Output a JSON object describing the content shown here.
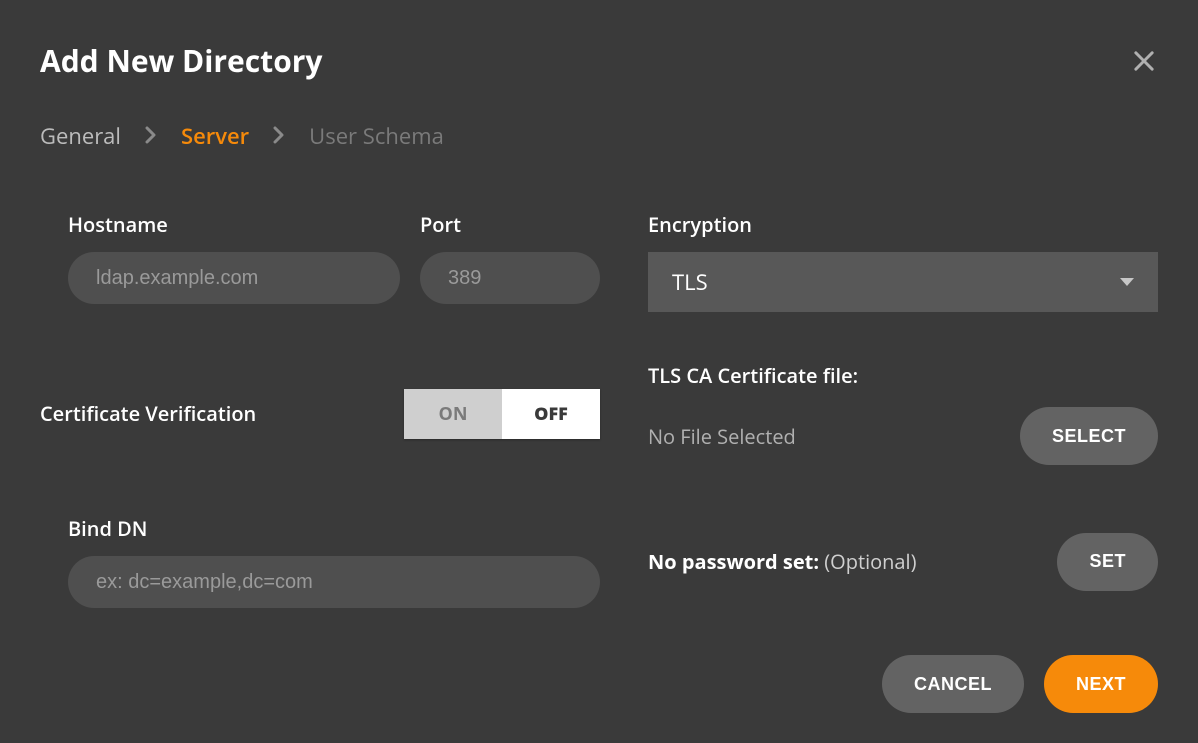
{
  "title": "Add New Directory",
  "breadcrumb": {
    "general": "General",
    "server": "Server",
    "user_schema": "User Schema"
  },
  "form": {
    "hostname": {
      "label": "Hostname",
      "placeholder": "ldap.example.com",
      "value": ""
    },
    "port": {
      "label": "Port",
      "placeholder": "389",
      "value": ""
    },
    "encryption": {
      "label": "Encryption",
      "value": "TLS"
    },
    "cert_verify": {
      "label": "Certificate Verification",
      "on": "ON",
      "off": "OFF",
      "state": "OFF"
    },
    "tls_ca": {
      "label": "TLS CA Certificate file:",
      "status": "No File Selected",
      "button": "SELECT"
    },
    "bind_dn": {
      "label": "Bind DN",
      "placeholder": "ex: dc=example,dc=com",
      "value": ""
    },
    "password": {
      "text_bold": "No password set:",
      "text_optional": "(Optional)",
      "button": "SET"
    }
  },
  "footer": {
    "cancel": "CANCEL",
    "next": "NEXT"
  }
}
